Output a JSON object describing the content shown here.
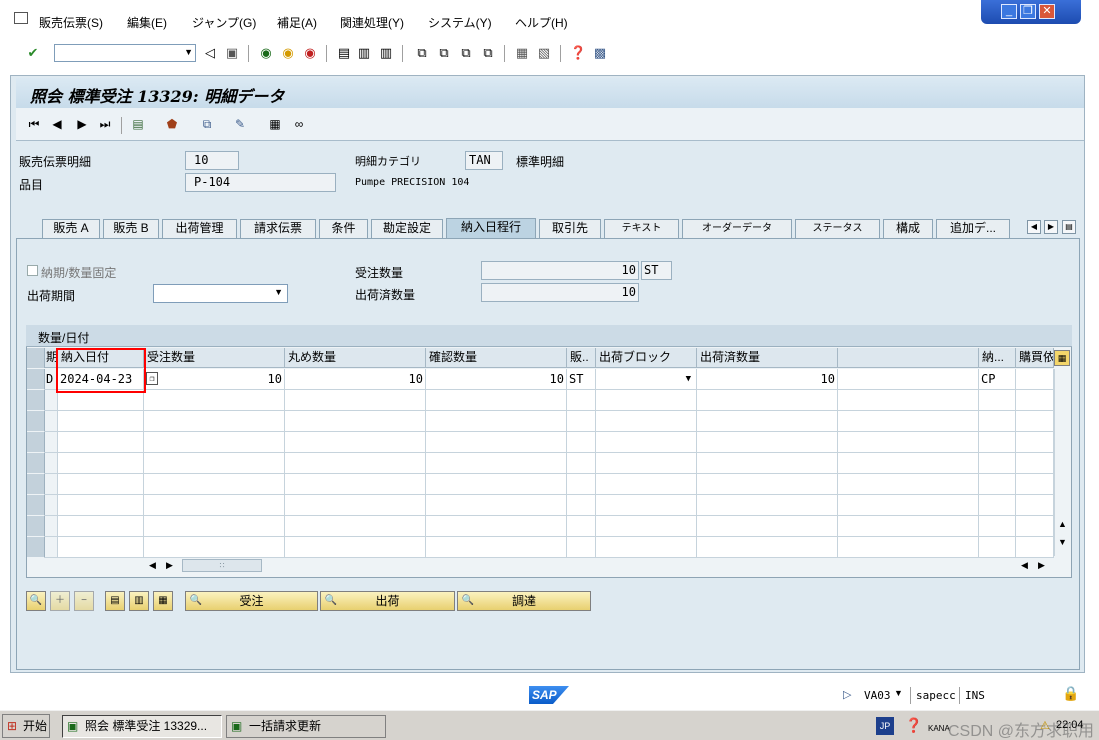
{
  "menubar": {
    "items": [
      "販売伝票(S)",
      "編集(E)",
      "ジャンプ(G)",
      "補足(A)",
      "関連処理(Y)",
      "システム(Y)",
      "ヘルプ(H)"
    ]
  },
  "window_controls": {
    "minimize": "_",
    "restore": "❐",
    "close": "✕"
  },
  "toolbar": {
    "command_value": ""
  },
  "title": "照会 標準受注 13329: 明細データ",
  "header": {
    "item_label": "販売伝票明細",
    "item_value": "10",
    "material_label": "品目",
    "material_value": "P-104",
    "category_label": "明細カテゴリ",
    "category_value": "TAN",
    "category_desc": "標準明細",
    "material_desc": "Pumpe PRECISION 104"
  },
  "tabs": [
    "販売 A",
    "販売 B",
    "出荷管理",
    "請求伝票",
    "条件",
    "勘定設定",
    "納入日程行",
    "取引先",
    "テキスト",
    "オーダーデータ",
    "ステータス",
    "構成",
    "追加デ..."
  ],
  "active_tab": "納入日程行",
  "schedule": {
    "fixed_label": "納期/数量固定",
    "period_label": "出荷期間",
    "period_value": "",
    "order_qty_label": "受注数量",
    "order_qty_value": "10",
    "order_qty_unit": "ST",
    "delivered_qty_label": "出荷済数量",
    "delivered_qty_value": "10"
  },
  "table": {
    "title": "数量/日付",
    "headers": [
      "期",
      "納入日付",
      "受注数量",
      "丸め数量",
      "確認数量",
      "販..",
      "出荷ブロック",
      "出荷済数量",
      "",
      "納...",
      "購買依"
    ],
    "rows": [
      [
        "D",
        "2024-04-23",
        "10",
        "10",
        "10",
        "ST",
        "",
        "10",
        "",
        "CP",
        ""
      ]
    ]
  },
  "buttons": {
    "order": "受注",
    "shipping": "出荷",
    "procurement": "調達"
  },
  "statusbar": {
    "logo": "SAP",
    "transaction": "VA03",
    "server": "sapecc",
    "mode": "INS"
  },
  "taskbar": {
    "start": "开始",
    "tasks": [
      "照会 標準受注 13329...",
      "一括請求更新"
    ],
    "lang": "JP",
    "ime": "KANA",
    "watermark": "CSDN @东方求职用",
    "clock": "22:04"
  },
  "colors": {
    "accent": "#1d4cb0",
    "highlight_box": "#ff0000",
    "panel": "#dfeaf1"
  }
}
